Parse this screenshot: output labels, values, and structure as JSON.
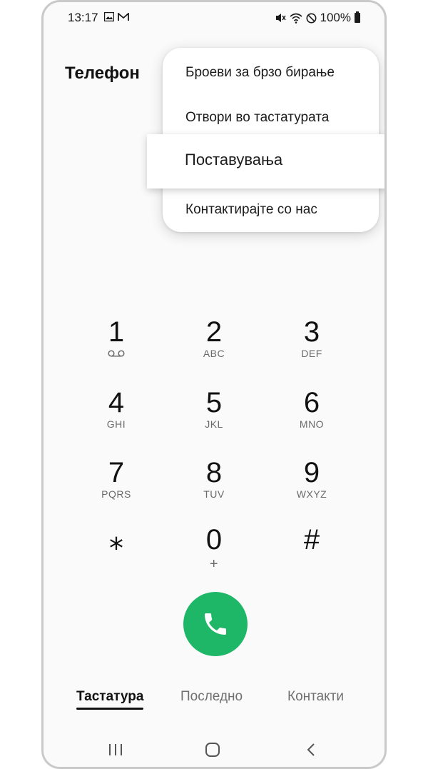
{
  "status_bar": {
    "time": "13:17",
    "battery_text": "100%",
    "left_icons": [
      "gallery-icon",
      "gmail-icon"
    ],
    "right_icons": [
      "mute-icon",
      "wifi-icon",
      "do-not-disturb-icon",
      "battery-icon"
    ]
  },
  "app": {
    "title": "Телефон"
  },
  "menu": {
    "items": [
      {
        "label": "Броеви за брзо бирање"
      },
      {
        "label": "Отвори во тастатурата"
      },
      {
        "label": "Поставувања",
        "highlighted": true
      },
      {
        "label": "Контактирајте со нас"
      }
    ]
  },
  "keypad": {
    "keys": [
      {
        "digit": "1",
        "letters": "",
        "icon": "voicemail-icon"
      },
      {
        "digit": "2",
        "letters": "ABC"
      },
      {
        "digit": "3",
        "letters": "DEF"
      },
      {
        "digit": "4",
        "letters": "GHI"
      },
      {
        "digit": "5",
        "letters": "JKL"
      },
      {
        "digit": "6",
        "letters": "MNO"
      },
      {
        "digit": "7",
        "letters": "PQRS"
      },
      {
        "digit": "8",
        "letters": "TUV"
      },
      {
        "digit": "9",
        "letters": "WXYZ"
      },
      {
        "digit": "⁎",
        "letters": ""
      },
      {
        "digit": "0",
        "letters": "+"
      },
      {
        "digit": "#",
        "letters": ""
      }
    ]
  },
  "call_button": {
    "icon": "phone-icon",
    "color": "#1db767"
  },
  "tabs": [
    {
      "label": "Тастатура",
      "active": true
    },
    {
      "label": "Последно",
      "active": false
    },
    {
      "label": "Контакти",
      "active": false
    }
  ],
  "nav_bar": {
    "icons": [
      "recent-apps-icon",
      "home-icon",
      "back-icon"
    ]
  }
}
